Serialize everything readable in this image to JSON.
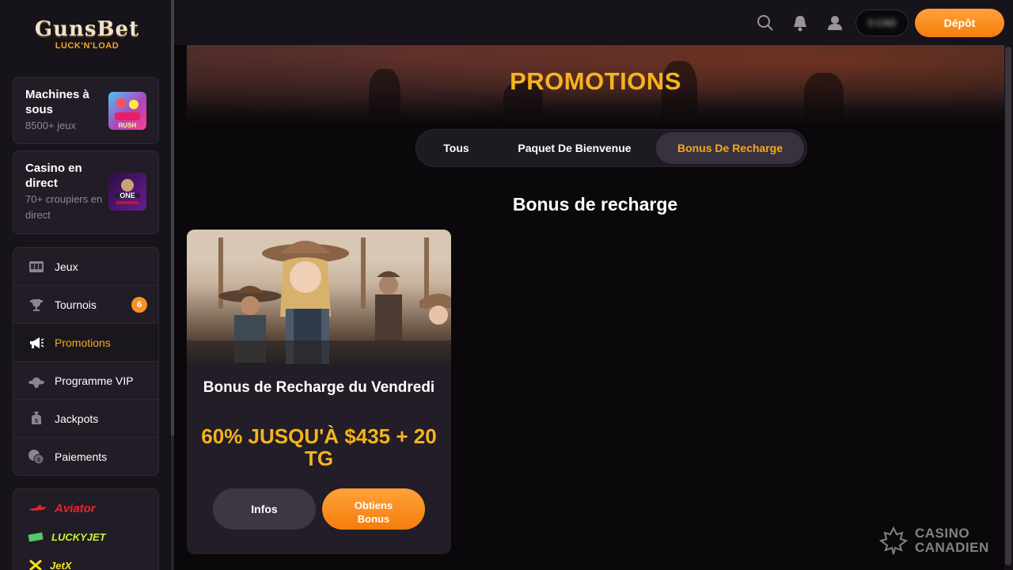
{
  "brand": {
    "name": "GunsBet",
    "logo_main": "GunsBet",
    "logo_sub": "LUCK'N'LOAD",
    "accent_color": "#f6a81d"
  },
  "sidebar": {
    "categories": [
      {
        "title": "Machines à sous",
        "subtitle": "8500+ jeux",
        "thumb_icon": "slot-thumb"
      },
      {
        "title": "Casino en direct",
        "subtitle": "70+ croupiers en direct",
        "thumb_icon": "live-casino-thumb"
      }
    ],
    "nav": [
      {
        "label": "Jeux",
        "icon": "slot-machine-icon",
        "active": false
      },
      {
        "label": "Tournois",
        "icon": "trophy-icon",
        "badge": "6",
        "active": false
      },
      {
        "label": "Promotions",
        "icon": "megaphone-icon",
        "active": true
      },
      {
        "label": "Programme VIP",
        "icon": "cowboy-hat-icon",
        "active": false
      },
      {
        "label": "Jackpots",
        "icon": "money-bag-icon",
        "active": false
      },
      {
        "label": "Paiements",
        "icon": "coins-icon",
        "active": false
      }
    ],
    "games": [
      {
        "label": "Aviator",
        "color": "#e8242e",
        "icon": "plane-icon"
      },
      {
        "label": "LUCKYJET",
        "color": "#c8f53a",
        "icon": "cash-icon"
      },
      {
        "label": "JetX",
        "color": "#f3e21a",
        "icon": "x-icon"
      }
    ]
  },
  "topbar": {
    "icons": [
      "search-icon",
      "bell-icon",
      "user-icon"
    ],
    "balance_masked": "0 CAD",
    "deposit_label": "Dépôt"
  },
  "page": {
    "title": "PROMOTIONS",
    "tabs": [
      {
        "label": "Tous",
        "active": false
      },
      {
        "label": "Paquet De Bienvenue",
        "active": false
      },
      {
        "label": "Bonus De Recharge",
        "active": true
      }
    ],
    "section_title": "Bonus de recharge"
  },
  "promos": [
    {
      "title": "Bonus de Recharge du Vendredi",
      "offer": "60% JUSQU'À $435 + 20 TG",
      "info_label": "Infos",
      "get_label_line1": "Obtiens",
      "get_label_line2": "Bonus"
    }
  ],
  "watermark": {
    "line1": "CASINO",
    "line2": "CANADIEN"
  }
}
